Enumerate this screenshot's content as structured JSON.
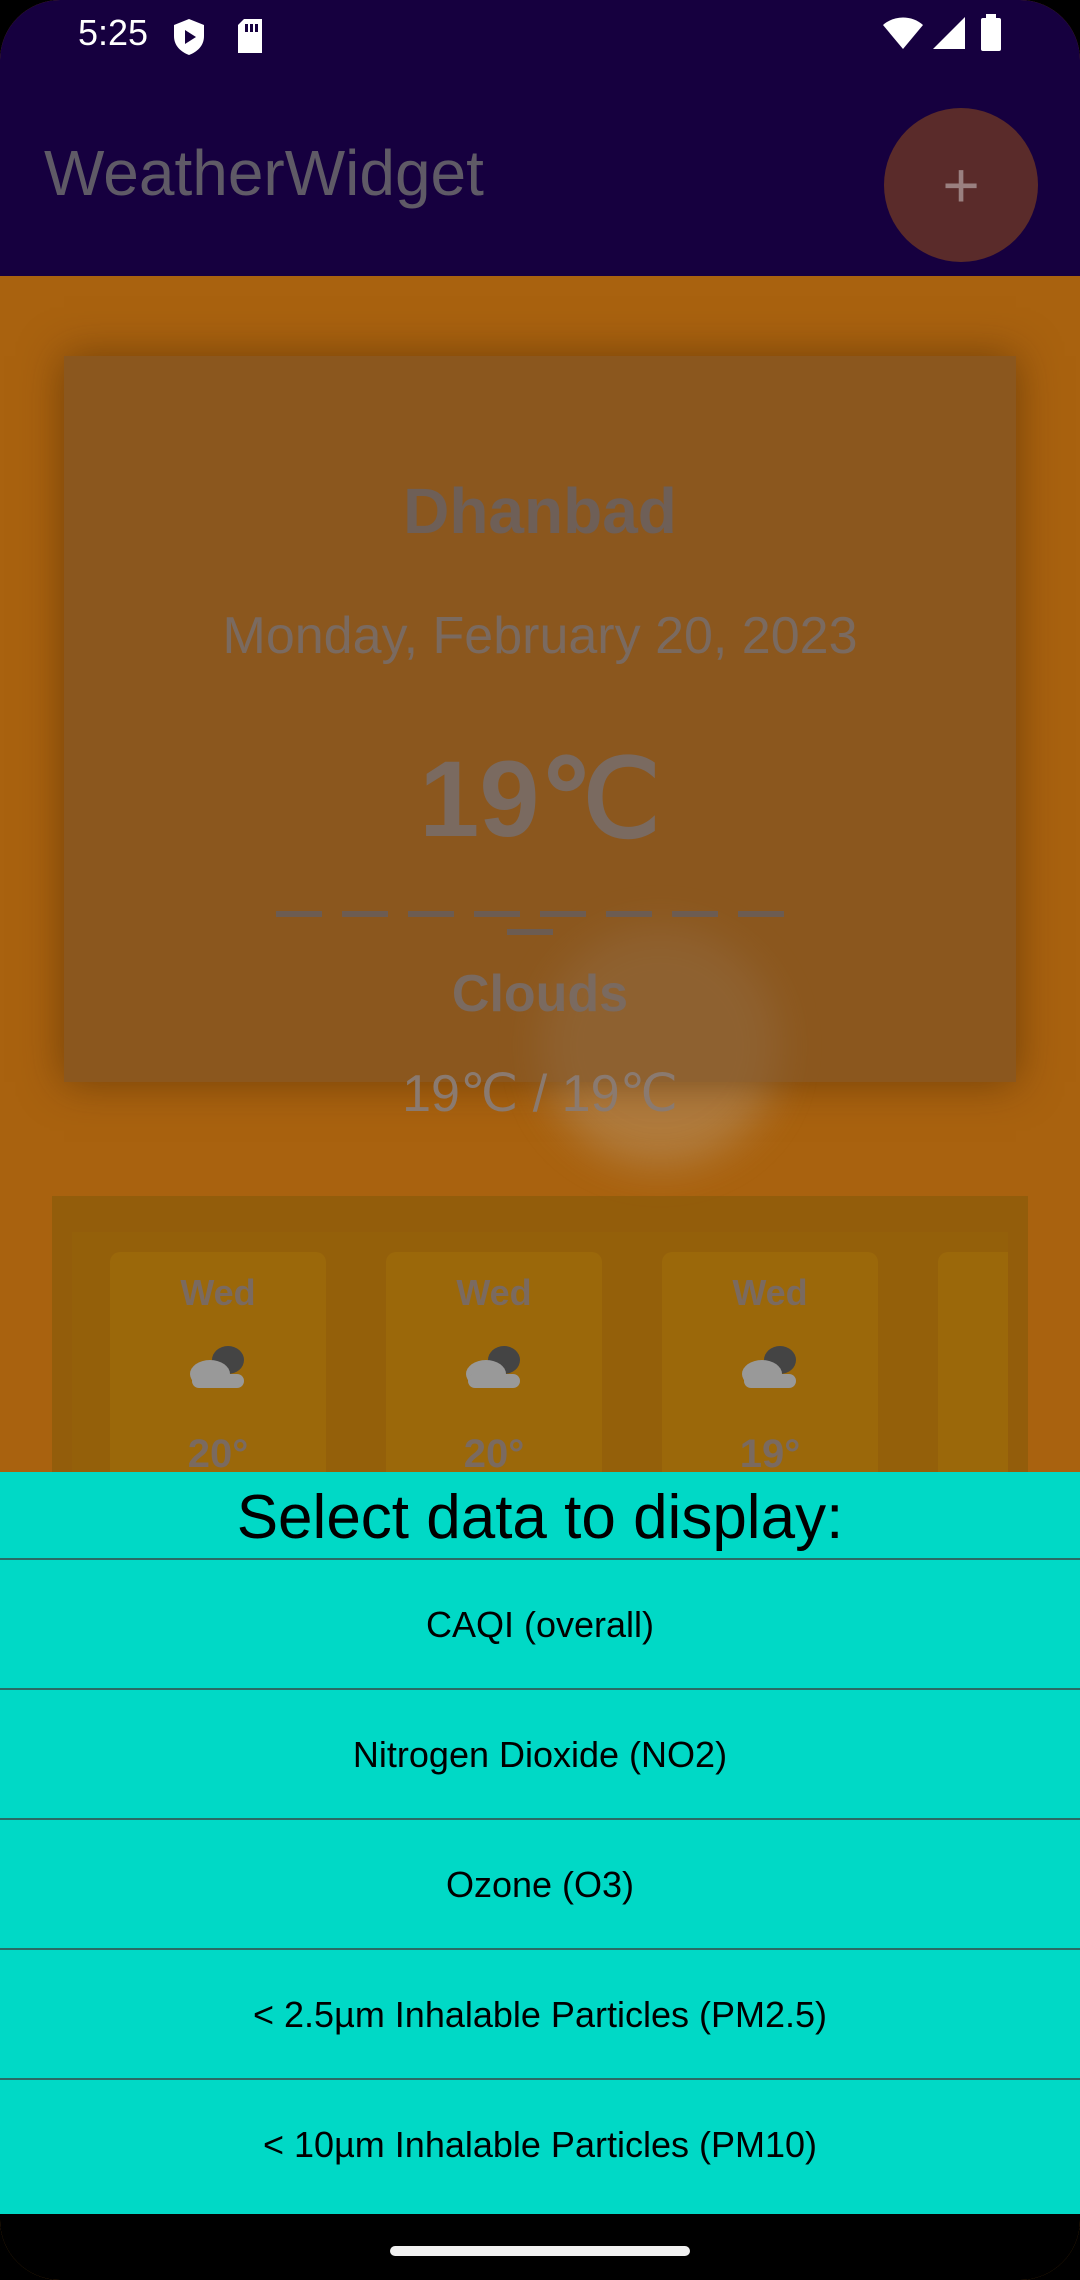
{
  "status_bar": {
    "time": "5:25",
    "icons": [
      "shield-play-icon",
      "sd-card-icon",
      "wifi-icon",
      "signal-icon",
      "battery-icon"
    ]
  },
  "app_bar": {
    "title": "WeatherWidget",
    "fab_label": "+"
  },
  "weather_card": {
    "city": "Dhanbad",
    "date": "Monday, February 20, 2023",
    "temperature": "19℃",
    "condition": "Clouds",
    "min_max": "19℃ / 19℃"
  },
  "forecast": [
    {
      "day": "Wed",
      "icon": "cloudy-icon",
      "temp": "20°"
    },
    {
      "day": "Wed",
      "icon": "cloudy-icon",
      "temp": "20°"
    },
    {
      "day": "Wed",
      "icon": "cloudy-icon",
      "temp": "19°"
    }
  ],
  "sheet": {
    "title": "Select data to display:",
    "options": [
      "CAQI (overall)",
      "Nitrogen Dioxide (NO2)",
      "Ozone (O3)",
      "< 2.5µm Inhalable Particles (PM2.5)",
      "< 10µm Inhalable Particles (PM10)"
    ]
  },
  "colors": {
    "status_bar": "#16003f",
    "sheet_background": "#00d9c6",
    "background": "#b56a12"
  }
}
